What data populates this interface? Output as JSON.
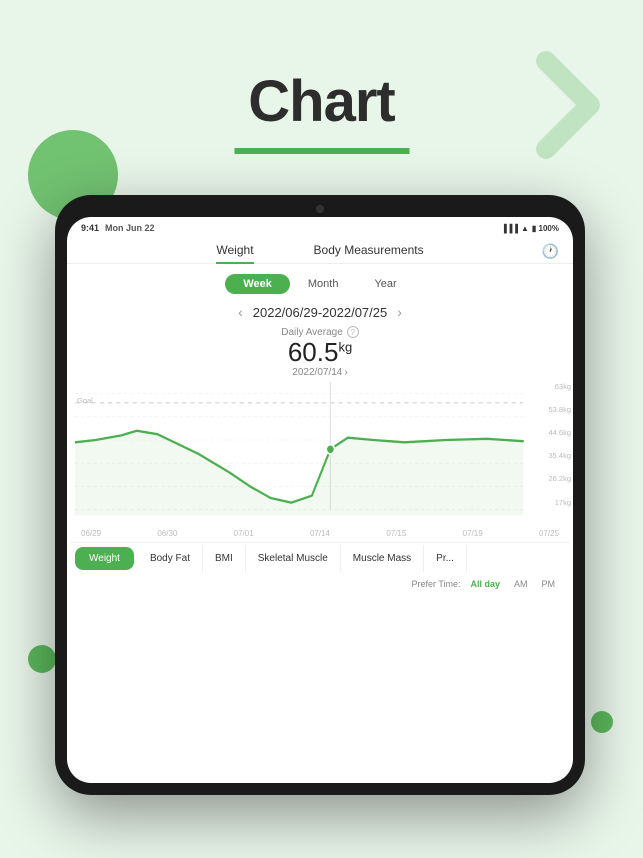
{
  "page": {
    "title": "Chart",
    "background_color": "#e8f5e9"
  },
  "status_bar": {
    "time": "9:41",
    "date": "Mon Jun 22",
    "signal": "●●●",
    "wifi": "wifi",
    "battery": "100%"
  },
  "nav": {
    "tabs": [
      {
        "id": "weight",
        "label": "Weight",
        "active": true
      },
      {
        "id": "body-measurements",
        "label": "Body Measurements",
        "active": false
      }
    ],
    "history_icon": "🕐"
  },
  "period": {
    "options": [
      {
        "id": "week",
        "label": "Week",
        "active": true
      },
      {
        "id": "month",
        "label": "Month",
        "active": false
      },
      {
        "id": "year",
        "label": "Year",
        "active": false
      }
    ]
  },
  "date_range": {
    "start": "2022/06/29",
    "end": "2022/07/25",
    "display": "2022/06/29-2022/07/25"
  },
  "stats": {
    "label": "Daily Average",
    "value": "60.5",
    "unit": "kg",
    "date": "2022/07/14"
  },
  "chart": {
    "goal_label": "Goal",
    "y_labels": [
      "63kg",
      "53.8kg",
      "44.6kg",
      "35.4kg",
      "26.2kg",
      "17kg"
    ],
    "x_labels": [
      "06/29",
      "06/30",
      "07/01",
      "07/14",
      "07/15",
      "07/19",
      "07/25"
    ]
  },
  "metric_tabs": [
    {
      "id": "weight",
      "label": "Weight",
      "active": true
    },
    {
      "id": "body-fat",
      "label": "Body Fat",
      "active": false
    },
    {
      "id": "bmi",
      "label": "BMI",
      "active": false
    },
    {
      "id": "skeletal-muscle",
      "label": "Skeletal Muscle",
      "active": false
    },
    {
      "id": "muscle-mass",
      "label": "Muscle Mass",
      "active": false
    },
    {
      "id": "prefer",
      "label": "Pr...",
      "active": false
    }
  ],
  "prefer_time": {
    "label": "Prefer Time:",
    "options": [
      {
        "id": "all-day",
        "label": "All day",
        "active": true
      },
      {
        "id": "am",
        "label": "AM",
        "active": false
      },
      {
        "id": "pm",
        "label": "PM",
        "active": false
      }
    ]
  }
}
